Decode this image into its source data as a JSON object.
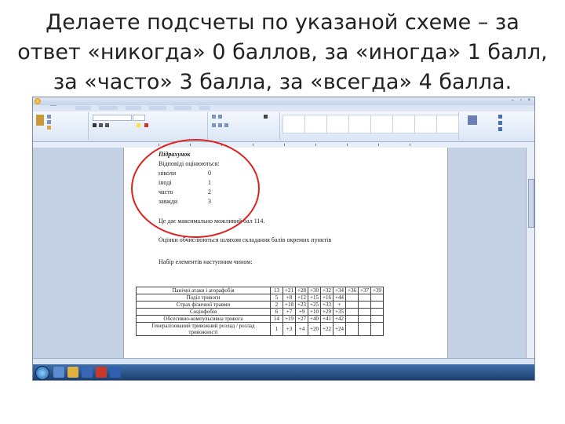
{
  "slide": {
    "title_line1": "Делаете подсчеты по указаной схеме – за",
    "title_line2": "ответ «никогда» 0 баллов, за «иногда» 1 балл,",
    "title_line3": "за «часто» 3 балла, за «всегда» 4 балла."
  },
  "word": {
    "accent_color": "#e0201e",
    "scale_heading": "Підрахунок",
    "scale_intro": "Відповіді оцінюються:",
    "scale": [
      {
        "label": "ніколи",
        "value": "0"
      },
      {
        "label": "іноді",
        "value": "1"
      },
      {
        "label": "часто",
        "value": "2"
      },
      {
        "label": "завжди",
        "value": "3"
      }
    ],
    "max_score": "Це дає максимально можливий бал 114.",
    "scores_note": "Оцінки обчислюються шляхом складання балів окремих пунктів",
    "items_intro": "Набір елементів наступним чином:",
    "table": [
      {
        "name": "Панічні атаки і агорафобія",
        "items": [
          "13",
          "+21",
          "+28",
          "+30",
          "+32",
          "+34",
          "+36",
          "+37",
          "+39"
        ]
      },
      {
        "name": "Поділ тривоги",
        "items": [
          "5",
          "+8",
          "+12",
          "+15",
          "+16",
          "+44",
          "",
          "",
          ""
        ]
      },
      {
        "name": "Страх фізичної травми",
        "items": [
          "2",
          "+18",
          "+23",
          "+25",
          "+33",
          "+",
          "",
          "",
          ""
        ]
      },
      {
        "name": "Соціофобія",
        "items": [
          "6",
          "+7",
          "+9",
          "+10",
          "+29",
          "+35",
          "",
          "",
          ""
        ]
      },
      {
        "name": "Обсесивно-компульсивна тривога",
        "items": [
          "14",
          "+19",
          "+27",
          "+40",
          "+41",
          "+42",
          "",
          "",
          ""
        ]
      },
      {
        "name": "Генералізований тривожний розлад / розлад тривожності",
        "items": [
          "1",
          "+3",
          "+4",
          "+20",
          "+22",
          "+24",
          "",
          "",
          ""
        ]
      }
    ]
  }
}
